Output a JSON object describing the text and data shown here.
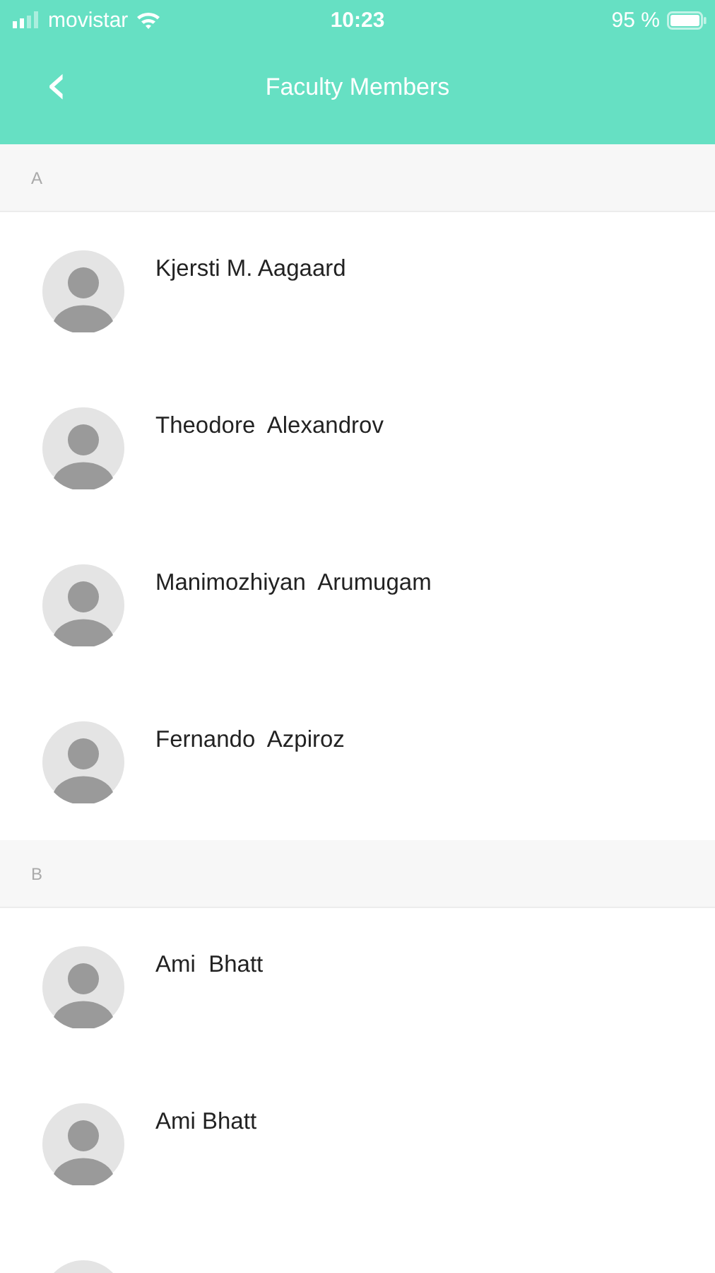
{
  "status_bar": {
    "carrier": "movistar",
    "time": "10:23",
    "battery": "95 %"
  },
  "header": {
    "back": "‹",
    "title": "Faculty Members"
  },
  "sections": [
    {
      "letter": "A",
      "members": [
        {
          "name": "Kjersti M. Aagaard"
        },
        {
          "name": "Theodore  Alexandrov"
        },
        {
          "name": "Manimozhiyan  Arumugam"
        },
        {
          "name": "Fernando  Azpiroz"
        }
      ]
    },
    {
      "letter": "B",
      "members": [
        {
          "name": "Ami  Bhatt"
        },
        {
          "name": "Ami Bhatt"
        }
      ],
      "more_below": true
    }
  ]
}
